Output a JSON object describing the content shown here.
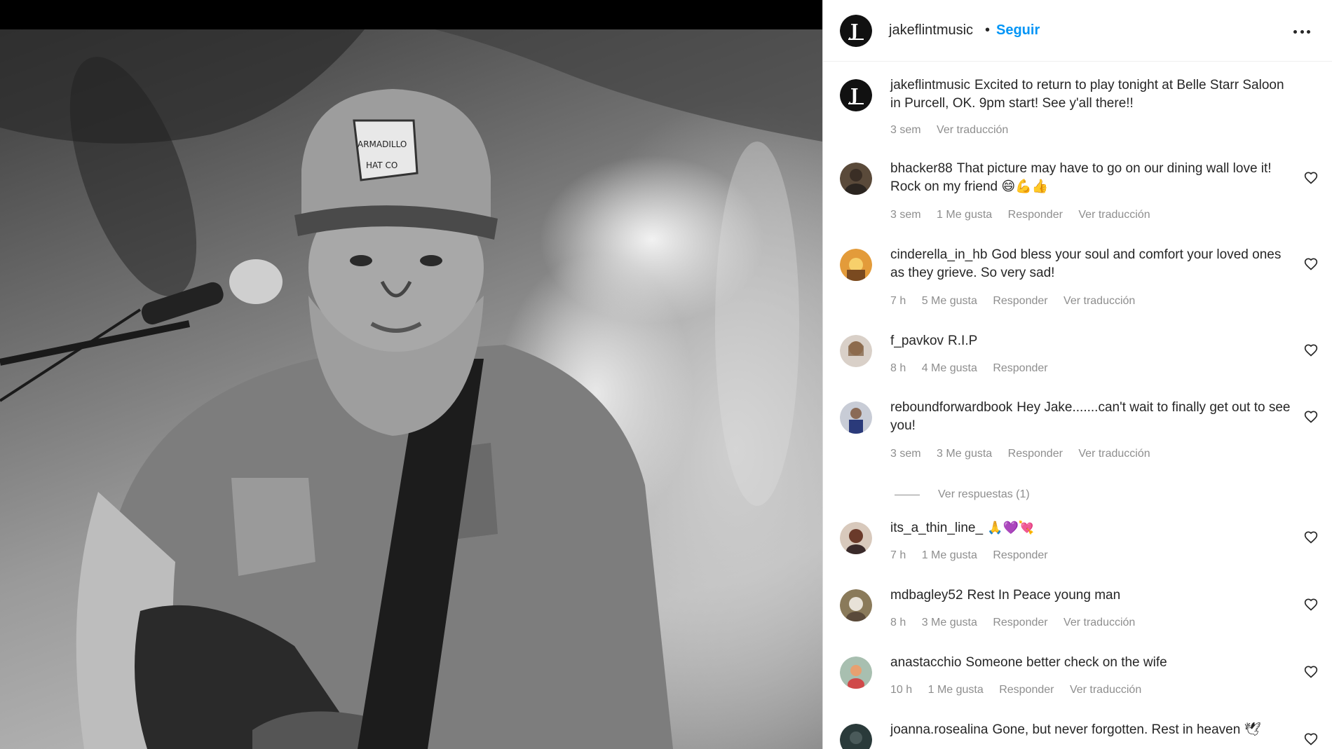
{
  "post": {
    "username": "jakeflintmusic",
    "separator": "•",
    "follow_label": "Seguir",
    "more_icon": "more-horizontal-icon",
    "image_description_alt": "Musician with cap and beard playing guitar on stage"
  },
  "caption": {
    "username": "jakeflintmusic",
    "text": "Excited to return to play tonight at Belle Starr Saloon in Purcell, OK. 9pm start! See y'all there!!",
    "time": "3 sem",
    "translate": "Ver traducción"
  },
  "comments": [
    {
      "username": "bhacker88",
      "text": "That picture may have to go on our dining wall love it! Rock on my friend 😄💪👍",
      "time": "3 sem",
      "likes": "1 Me gusta",
      "reply": "Responder",
      "translate": "Ver traducción"
    },
    {
      "username": "cinderella_in_hb",
      "text": "God bless your soul and comfort your loved ones as they grieve. So very sad!",
      "time": "7 h",
      "likes": "5 Me gusta",
      "reply": "Responder",
      "translate": "Ver traducción"
    },
    {
      "username": "f_pavkov",
      "text": "R.I.P",
      "time": "8 h",
      "likes": "4 Me gusta",
      "reply": "Responder",
      "translate": ""
    },
    {
      "username": "reboundforwardbook",
      "text": "Hey Jake.......can't wait to finally get out to see you!",
      "time": "3 sem",
      "likes": "3 Me gusta",
      "reply": "Responder",
      "translate": "Ver traducción",
      "view_replies": "Ver respuestas (1)"
    },
    {
      "username": "its_a_thin_line_",
      "text": "🙏💜💘",
      "time": "7 h",
      "likes": "1 Me gusta",
      "reply": "Responder",
      "translate": ""
    },
    {
      "username": "mdbagley52",
      "text": "Rest In Peace young man",
      "time": "8 h",
      "likes": "3 Me gusta",
      "reply": "Responder",
      "translate": "Ver traducción"
    },
    {
      "username": "anastacchio",
      "text": "Someone better check on the wife",
      "time": "10 h",
      "likes": "1 Me gusta",
      "reply": "Responder",
      "translate": "Ver traducción"
    },
    {
      "username": "joanna.rosealina",
      "text": "Gone, but never forgotten. Rest in heaven 🕊",
      "time": "",
      "likes": "",
      "reply": "",
      "translate": ""
    }
  ],
  "icons": {
    "heart": "heart-outline-icon"
  },
  "colors": {
    "follow": "#0095f6",
    "text": "#262626",
    "meta": "#8e8e8e"
  }
}
